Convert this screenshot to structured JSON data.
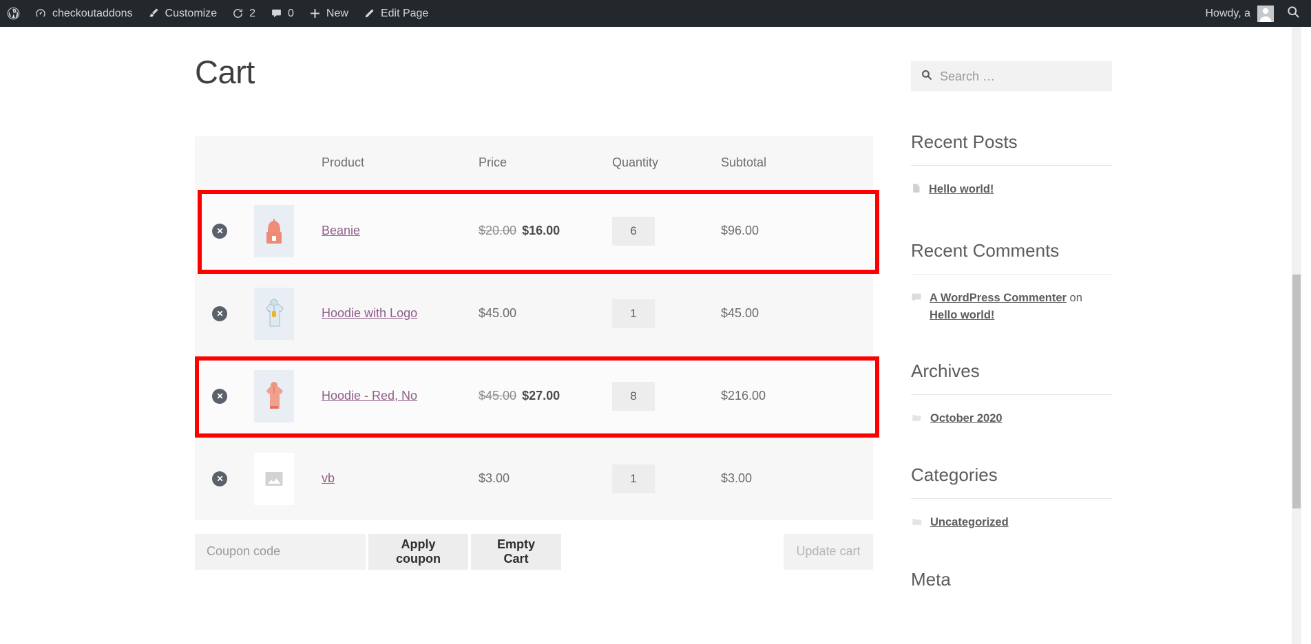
{
  "adminbar": {
    "logo_icon": "wordpress-logo-icon",
    "items": [
      {
        "icon": "dashboard-icon",
        "label": "checkoutaddons"
      },
      {
        "icon": "customize-brush-icon",
        "label": "Customize"
      },
      {
        "icon": "updates-icon",
        "label": "2"
      },
      {
        "icon": "comment-bubble-icon",
        "label": "0"
      },
      {
        "icon": "plus-icon",
        "label": "New"
      },
      {
        "icon": "pencil-icon",
        "label": "Edit Page"
      }
    ],
    "howdy": "Howdy, a",
    "avatar_icon": "user-avatar-icon",
    "search_icon": "search-icon"
  },
  "page": {
    "title": "Cart"
  },
  "cart": {
    "headers": {
      "remove": "",
      "thumbnail": "",
      "product": "Product",
      "price": "Price",
      "quantity": "Quantity",
      "subtotal": "Subtotal"
    },
    "rows": [
      {
        "remove_icon": "remove-item-icon",
        "thumbnail_icon": "beanie-product-thumbnail",
        "name": "Beanie",
        "price_old": "$20.00",
        "price_new": "$16.00",
        "on_sale": true,
        "quantity": "6",
        "subtotal": "$96.00",
        "highlighted": true
      },
      {
        "remove_icon": "remove-item-icon",
        "thumbnail_icon": "hoodie-with-logo-product-thumbnail",
        "name": "Hoodie with Logo",
        "price_old": "",
        "price_new": "$45.00",
        "on_sale": false,
        "quantity": "1",
        "subtotal": "$45.00",
        "highlighted": false
      },
      {
        "remove_icon": "remove-item-icon",
        "thumbnail_icon": "hoodie-red-product-thumbnail",
        "name": "Hoodie - Red, No",
        "price_old": "$45.00",
        "price_new": "$27.00",
        "on_sale": true,
        "quantity": "8",
        "subtotal": "$216.00",
        "highlighted": true
      },
      {
        "remove_icon": "remove-item-icon",
        "thumbnail_icon": "placeholder-image-thumbnail",
        "name": "vb",
        "price_old": "",
        "price_new": "$3.00",
        "on_sale": false,
        "quantity": "1",
        "subtotal": "$3.00",
        "highlighted": false
      }
    ],
    "actions": {
      "coupon_value": "",
      "coupon_placeholder": "Coupon code",
      "apply_coupon_label": "Apply coupon",
      "empty_cart_label": "Empty Cart",
      "update_cart_label": "Update cart"
    }
  },
  "sidebar": {
    "search": {
      "icon": "search-icon",
      "value": "",
      "placeholder": "Search …"
    },
    "widgets": [
      {
        "title": "Recent Posts",
        "items": [
          {
            "icon": "post-page-icon",
            "link": "Hello world!",
            "suffix": "",
            "link2": ""
          }
        ]
      },
      {
        "title": "Recent Comments",
        "items": [
          {
            "icon": "comment-bubble-icon",
            "link": "A WordPress Commenter",
            "suffix": " on ",
            "link2": "Hello world!"
          }
        ]
      },
      {
        "title": "Archives",
        "items": [
          {
            "icon": "folder-open-icon",
            "link": "October 2020",
            "suffix": "",
            "link2": ""
          }
        ]
      },
      {
        "title": "Categories",
        "items": [
          {
            "icon": "folder-icon",
            "link": "Uncategorized",
            "suffix": "",
            "link2": ""
          }
        ]
      },
      {
        "title": "Meta",
        "items": []
      }
    ]
  },
  "colors": {
    "adminbar_bg": "#23282d",
    "highlight_red": "#fe0000",
    "product_link": "#8f5e8a",
    "row_bg": "#fbfbfb",
    "row_alt_bg": "#f7f7f7"
  }
}
